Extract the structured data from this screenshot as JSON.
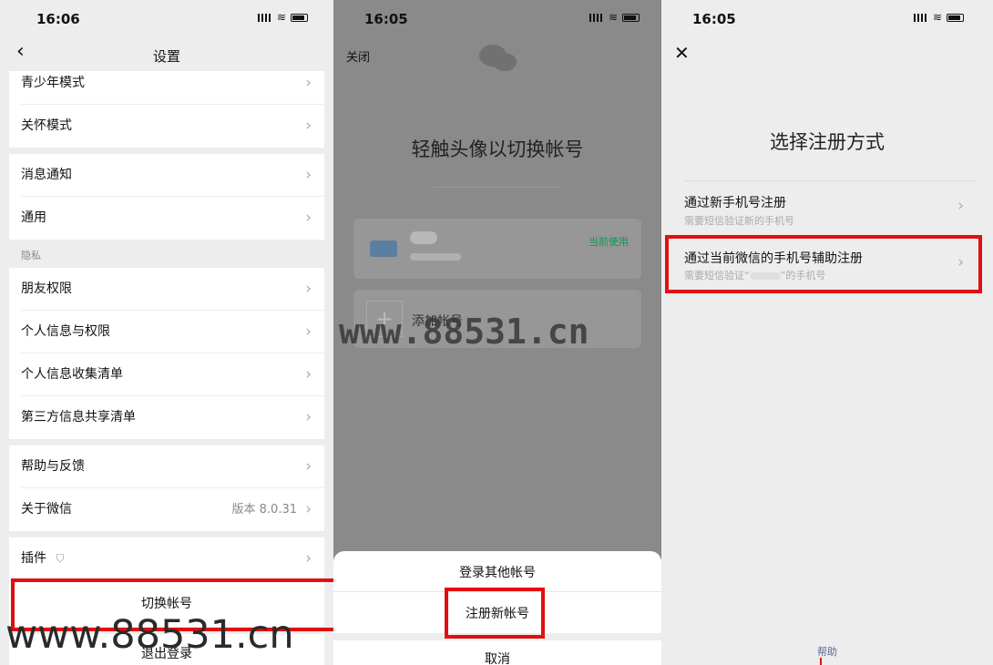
{
  "panel1": {
    "time": "16:06",
    "title": "设置",
    "items": [
      {
        "label": "青少年模式"
      },
      {
        "label": "关怀模式"
      },
      {
        "label": "消息通知"
      },
      {
        "label": "通用"
      },
      {
        "label": "朋友权限"
      },
      {
        "label": "个人信息与权限"
      },
      {
        "label": "个人信息收集清单"
      },
      {
        "label": "第三方信息共享清单"
      },
      {
        "label": "帮助与反馈"
      },
      {
        "label": "关于微信",
        "value": "版本 8.0.31"
      },
      {
        "label": "插件"
      }
    ],
    "privacy_section": "隐私",
    "switch_account": "切换帐号",
    "logout": "退出登录"
  },
  "panel2": {
    "time": "16:05",
    "close": "关闭",
    "title": "轻触头像以切换帐号",
    "current_tag": "当前使用",
    "add_account": "添加帐号",
    "sheet": {
      "login_other": "登录其他帐号",
      "register_new": "注册新帐号",
      "cancel": "取消"
    }
  },
  "panel3": {
    "time": "16:05",
    "title": "选择注册方式",
    "option1": {
      "title": "通过新手机号注册",
      "sub": "需要短信验证新的手机号"
    },
    "option2": {
      "title": "通过当前微信的手机号辅助注册",
      "sub_pre": "需要短信验证“",
      "sub_post": "”的手机号"
    },
    "help": "帮助"
  },
  "watermark": {
    "center": "www.88531.cn",
    "bottom": "www.88531.cn"
  },
  "colors": {
    "highlight": "#e01010",
    "current_green": "#07c160"
  },
  "icons": {
    "back": "chevron-left-icon",
    "chevron": "chevron-right-icon",
    "close": "close-icon",
    "shield": "shield-icon",
    "wechat": "wechat-logo-icon",
    "plus": "plus-icon"
  }
}
